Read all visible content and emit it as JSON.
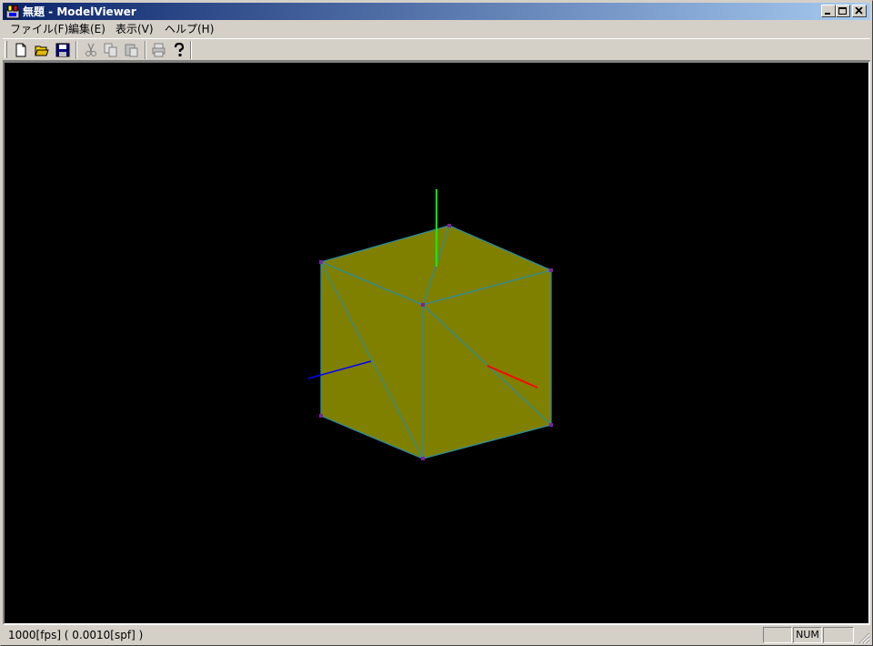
{
  "window": {
    "title": "無題 - ModelViewer"
  },
  "menu": {
    "items": [
      {
        "label": "ファイル(F)"
      },
      {
        "label": "編集(E)"
      },
      {
        "label": "表示(V)"
      },
      {
        "label": "ヘルプ(H)"
      }
    ]
  },
  "toolbar": {
    "buttons": [
      "new-file-icon",
      "open-folder-icon",
      "save-icon",
      "cut-icon",
      "copy-icon",
      "paste-icon",
      "print-icon",
      "help-icon"
    ]
  },
  "viewport": {
    "background": "#000000",
    "face_color": "#808000",
    "edge_color": "#2e8b99",
    "vertex_color": "#7b1fa2",
    "axis_colors": {
      "x": "#ff0000",
      "y": "#00ff00",
      "z": "#0000ff"
    }
  },
  "status": {
    "text": "1000[fps] ( 0.0010[spf] )",
    "pane_caps": "",
    "pane_num": "NUM",
    "pane_scrl": ""
  }
}
